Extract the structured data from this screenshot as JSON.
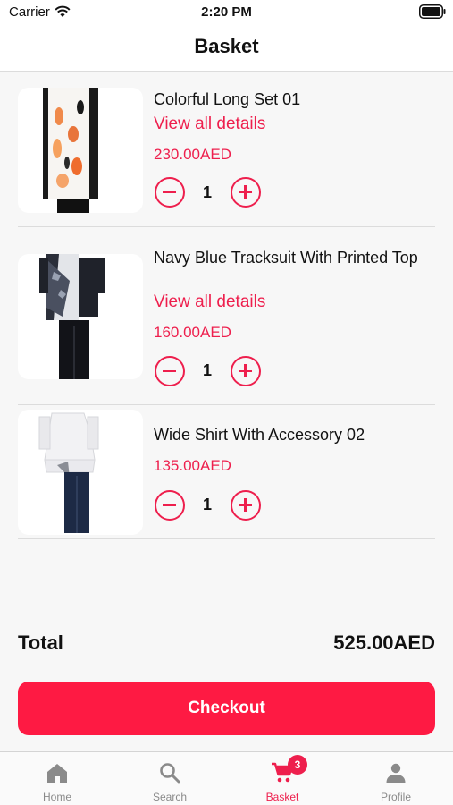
{
  "status_bar": {
    "carrier": "Carrier",
    "time": "2:20 PM"
  },
  "header": {
    "title": "Basket"
  },
  "basket": {
    "items": [
      {
        "name": "Colorful Long Set 01",
        "details_link": "View all details",
        "price": "230.00AED",
        "quantity": "1"
      },
      {
        "name": "Navy Blue Tracksuit With Printed Top",
        "details_link": "View all details",
        "price": "160.00AED",
        "quantity": "1"
      },
      {
        "name": "Wide Shirt With Accessory 02",
        "price": "135.00AED",
        "quantity": "1"
      }
    ]
  },
  "summary": {
    "total_label": "Total",
    "total_value": "525.00AED"
  },
  "checkout_button": {
    "label": "Checkout"
  },
  "tab_bar": {
    "tabs": [
      {
        "label": "Home",
        "icon": "home-icon"
      },
      {
        "label": "Search",
        "icon": "search-icon"
      },
      {
        "label": "Basket",
        "icon": "cart-icon",
        "badge": "3",
        "active": true
      },
      {
        "label": "Profile",
        "icon": "person-icon"
      }
    ]
  },
  "colors": {
    "accent": "#ee1f4d",
    "button": "#fe1a43",
    "inactive_tab": "#8a8a8a"
  }
}
